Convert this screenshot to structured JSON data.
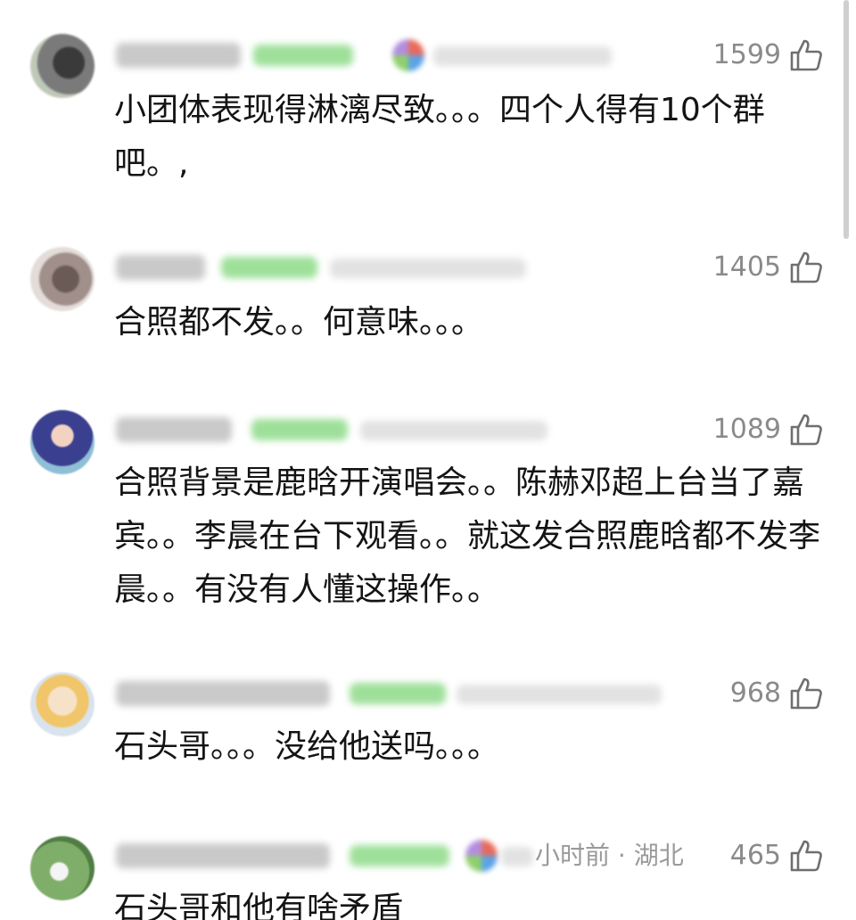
{
  "comments": [
    {
      "likes": "1599",
      "text": "小团体表现得淋漓尽致。。。四个人得有10个群吧。,",
      "location_text": ""
    },
    {
      "likes": "1405",
      "text": "合照都不发。。何意味。。。",
      "location_text": ""
    },
    {
      "likes": "1089",
      "text": "合照背景是鹿晗开演唱会。。陈赫邓超上台当了嘉宾。。李晨在台下观看。。就这发合照鹿晗都不发李晨。。有没有人懂这操作。。",
      "location_text": ""
    },
    {
      "likes": "968",
      "text": "石头哥。。。没给他送吗。。。",
      "location_text": ""
    },
    {
      "likes": "465",
      "text": "石头哥和他有啥矛盾",
      "location_text": "小时前 · 湖北"
    }
  ],
  "icons": {
    "like": "thumbs-up-icon"
  },
  "colors": {
    "like_count": "#8a8a8a",
    "body_text": "#141414",
    "badge_blur": "#9ee09a"
  }
}
